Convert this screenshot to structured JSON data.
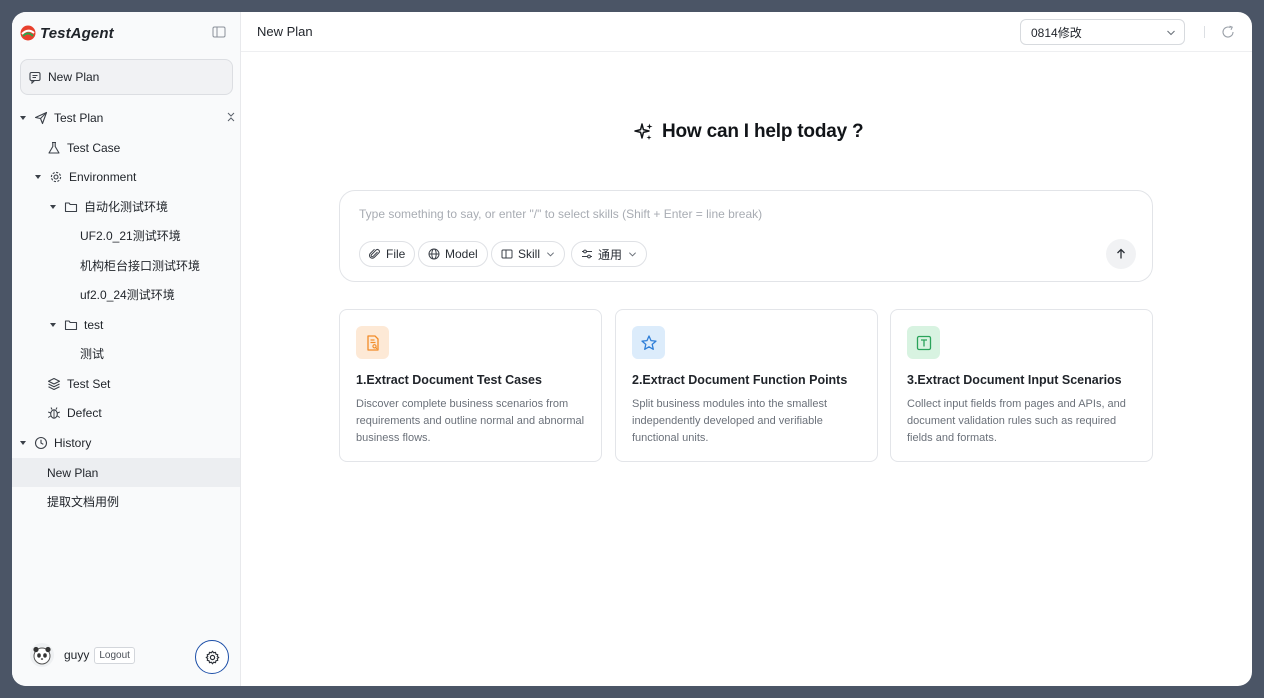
{
  "brand": {
    "name": "TestAgent"
  },
  "sidebar": {
    "new_plan_label": "New Plan",
    "tree": [
      {
        "label": "Test Plan"
      },
      {
        "label": "Test Case"
      },
      {
        "label": "Environment"
      },
      {
        "label": "自动化测试环境"
      },
      {
        "label": "UF2.0_21测试环境"
      },
      {
        "label": "机构柜台接口测试环境"
      },
      {
        "label": "uf2.0_24测试环境"
      },
      {
        "label": "test"
      },
      {
        "label": "测试"
      },
      {
        "label": "Test Set"
      },
      {
        "label": "Defect"
      },
      {
        "label": "History"
      },
      {
        "label": "New Plan"
      },
      {
        "label": "提取文档用例"
      }
    ],
    "user": {
      "name": "guyy",
      "logout_label": "Logout"
    }
  },
  "header": {
    "title": "New Plan",
    "version": "0814修改"
  },
  "hero": {
    "title": "How can I help today ?"
  },
  "chat": {
    "placeholder": "Type something to say, or enter \"/\" to select skills (Shift + Enter = line break)",
    "chips": {
      "file": "File",
      "model": "Model",
      "skill": "Skill",
      "general": "通用"
    }
  },
  "cards": [
    {
      "title": "1.Extract Document Test Cases",
      "desc": "Discover complete business scenarios from requirements and outline normal and abnormal business flows.",
      "icon": "document-search-icon",
      "color": "#f28c28"
    },
    {
      "title": "2.Extract Document Function Points",
      "desc": "Split business modules into the smallest independently developed and verifiable functional units.",
      "icon": "star-icon",
      "color": "#2f7fd8"
    },
    {
      "title": "3.Extract Document Input Scenarios",
      "desc": "Collect input fields from pages and APIs, and document validation rules such as required fields and formats.",
      "icon": "text-box-icon",
      "color": "#2aa35a"
    }
  ],
  "colors": {
    "accent": "#1d4fa8",
    "sidebar_bg": "#f9fafb",
    "frame": "#4b5566"
  }
}
